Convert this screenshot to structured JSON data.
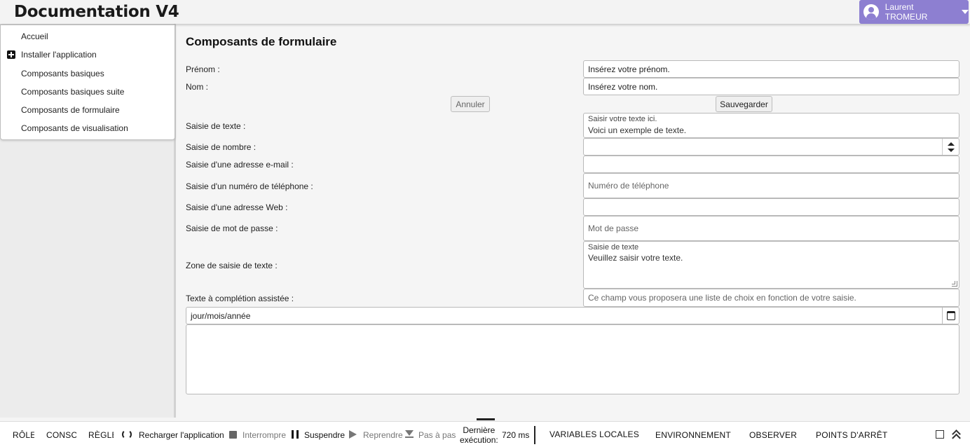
{
  "header": {
    "app_title": "Documentation V4",
    "user_name": "Laurent TROMEUR"
  },
  "sidebar": {
    "items": [
      {
        "label": "Accueil"
      },
      {
        "label": "Installer l'application",
        "icon": "plus-square-icon"
      },
      {
        "label": "Composants basiques"
      },
      {
        "label": "Composants basiques suite"
      },
      {
        "label": "Composants de formulaire"
      },
      {
        "label": "Composants de visualisation"
      }
    ]
  },
  "form": {
    "title": "Composants de formulaire",
    "prenom": {
      "label": "Prénom :",
      "value": "Insérez votre prénom."
    },
    "nom": {
      "label": "Nom :",
      "value": "Insérez votre nom."
    },
    "cancel_label": "Annuler",
    "save_label": "Sauvegarder",
    "text_input": {
      "label": "Saisie de texte :",
      "floating_label": "Saisir votre texte ici.",
      "value": "Voici un exemple de texte."
    },
    "number_input": {
      "label": "Saisie de nombre :",
      "value": ""
    },
    "email_input": {
      "label": "Saisie d'une adresse e-mail :",
      "value": ""
    },
    "phone_input": {
      "label": "Saisie d'un numéro de téléphone :",
      "placeholder": "Numéro de téléphone"
    },
    "url_input": {
      "label": "Saisie d'une adresse Web :",
      "value": ""
    },
    "password_input": {
      "label": "Saisie de mot de passe :",
      "placeholder": "Mot de passe"
    },
    "textarea": {
      "label": "Zone de saisie de texte :",
      "floating_label": "Saisie de texte",
      "value": "Veuillez saisir votre texte."
    },
    "autocomplete": {
      "label": "Texte à complétion assistée :",
      "placeholder": "Ce champ vous proposera une liste de choix en fonction de votre saisie."
    },
    "date_input": {
      "value": "jour/mois/année"
    }
  },
  "devbar": {
    "roles": "RÔLES",
    "console": "CONSOLE",
    "rules": "RÈGLES",
    "reload": "Recharger l'application",
    "interrupt": "Interrompre",
    "suspend": "Suspendre",
    "resume": "Reprendre",
    "step": "Pas à pas",
    "last_exec_line1": "Dernière",
    "last_exec_line2": "exécution:",
    "last_exec_value": "720 ms",
    "local_vars": "VARIABLES LOCALES",
    "environment": "ENVIRONNEMENT",
    "observe": "OBSERVER",
    "breakpoints": "POINTS D'ARRÊT"
  },
  "colors": {
    "accent": "#8d7fd1",
    "toolbar_bg": "#ffffff",
    "page_bg": "#f5f5f5"
  }
}
